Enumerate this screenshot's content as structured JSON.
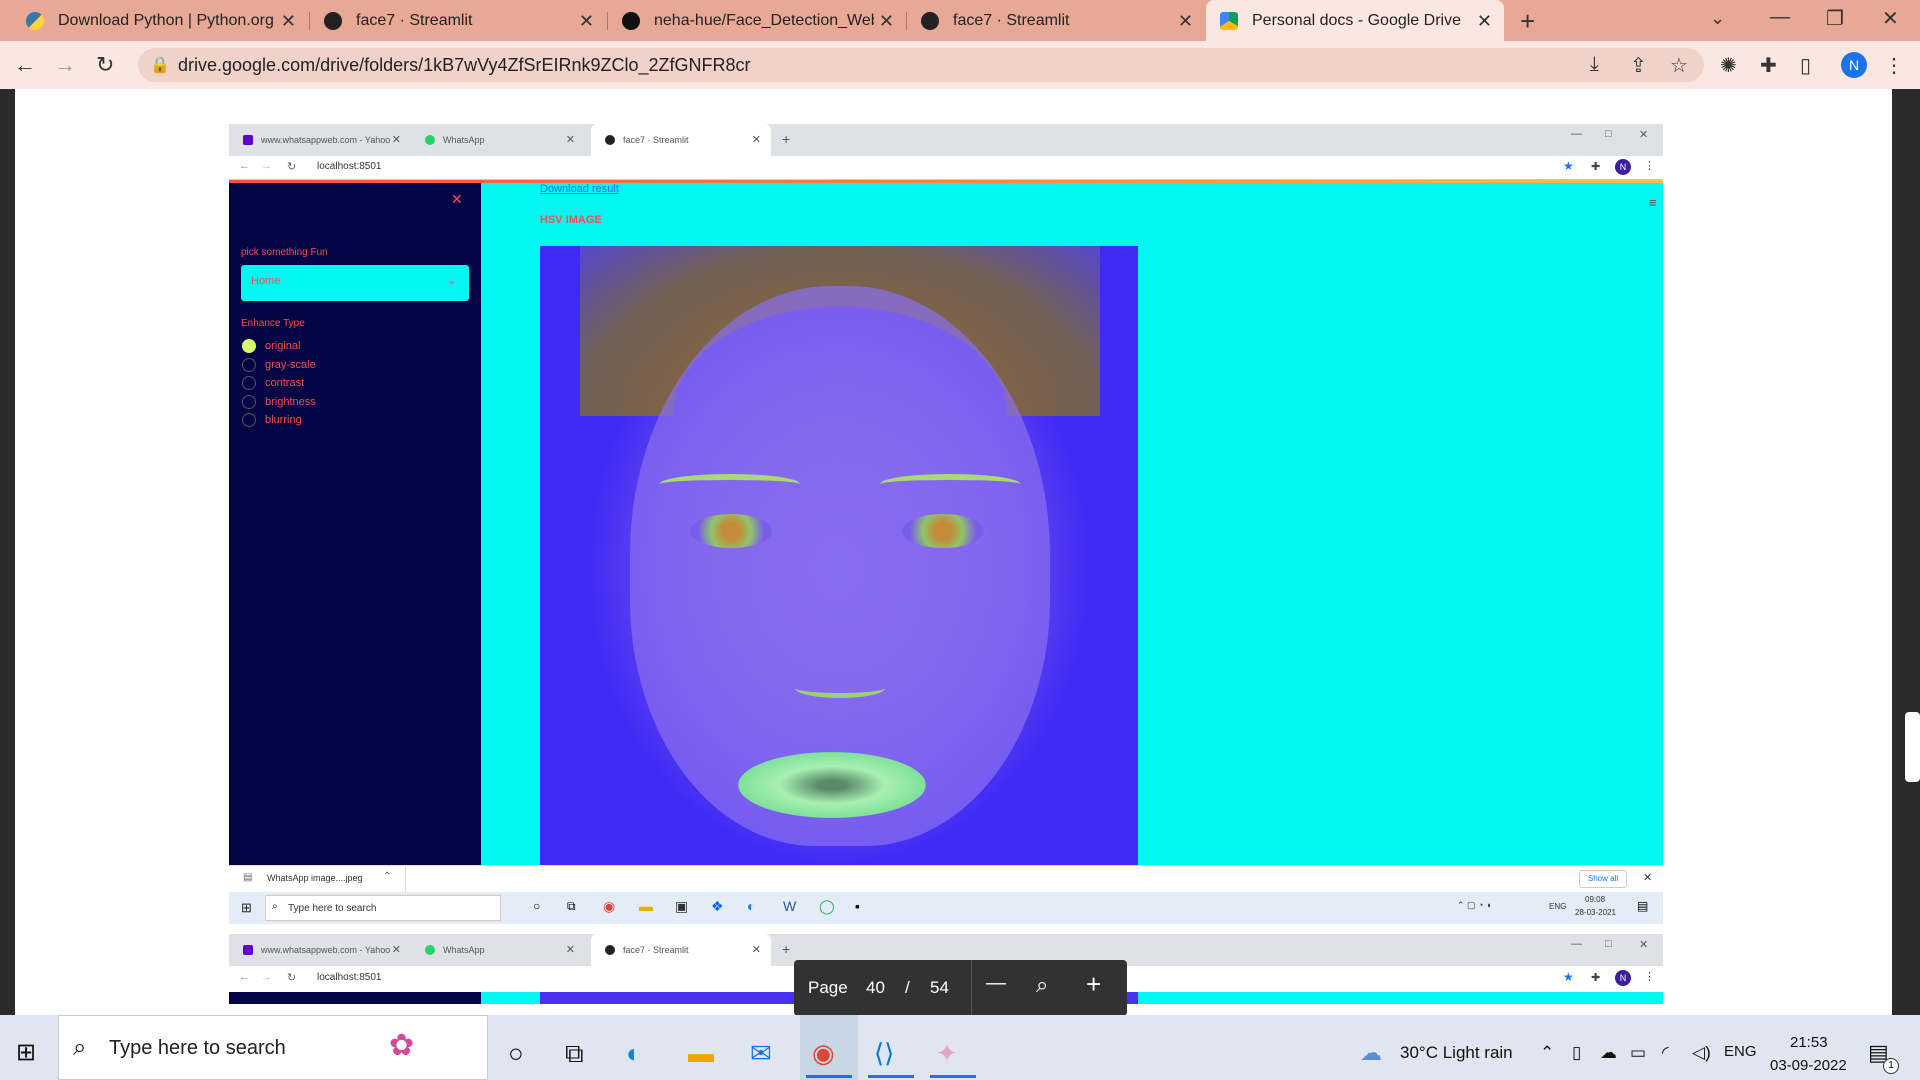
{
  "browser": {
    "tabs": [
      {
        "title": "Download Python | Python.org"
      },
      {
        "title": "face7 · Streamlit"
      },
      {
        "title": "neha-hue/Face_Detection_WebA"
      },
      {
        "title": "face7 · Streamlit"
      },
      {
        "title": "Personal docs - Google Drive",
        "active": true
      }
    ],
    "new_tab": "+",
    "url": "drive.google.com/drive/folders/1kB7wVy4ZfSrEIRnk9ZClo_2ZfGNFR8cr",
    "profile_initial": "N"
  },
  "inner": {
    "tabs": [
      "www.whatsappweb.com - Yahoo",
      "WhatsApp",
      "face7 · Streamlit"
    ],
    "url": "localhost:8501",
    "profile_initial": "N",
    "download_link": "Download result",
    "image_label": "HSV IMAGE",
    "sidebar": {
      "pick_label": "pick something Fun",
      "select_value": "Home",
      "enhance_label": "Enhance Type",
      "options": [
        "original",
        "gray-scale",
        "contrast",
        "brightness",
        "blurring"
      ],
      "selected": "original"
    },
    "download_file": "WhatsApp image....jpeg",
    "show_all": "Show all",
    "taskbar_search": "Type here to search",
    "tray_lang": "ENG",
    "tray_time": "09:08",
    "tray_date": "28-03-2021"
  },
  "viewer": {
    "page_label": "Page",
    "current_page": "40",
    "slash": "/",
    "total_pages": "54",
    "zoom_out": "—",
    "zoom_in": "+"
  },
  "taskbar": {
    "search_placeholder": "Type here to search",
    "weather": "30°C  Light rain",
    "language": "ENG",
    "time": "21:53",
    "date": "03-09-2022",
    "notification_count": "1"
  },
  "colors": {
    "tab_strip": "#e8a896",
    "streamlit_bg": "#00f7f2",
    "sidebar_bg": "#030545",
    "accent_red": "#ff4b4b"
  }
}
